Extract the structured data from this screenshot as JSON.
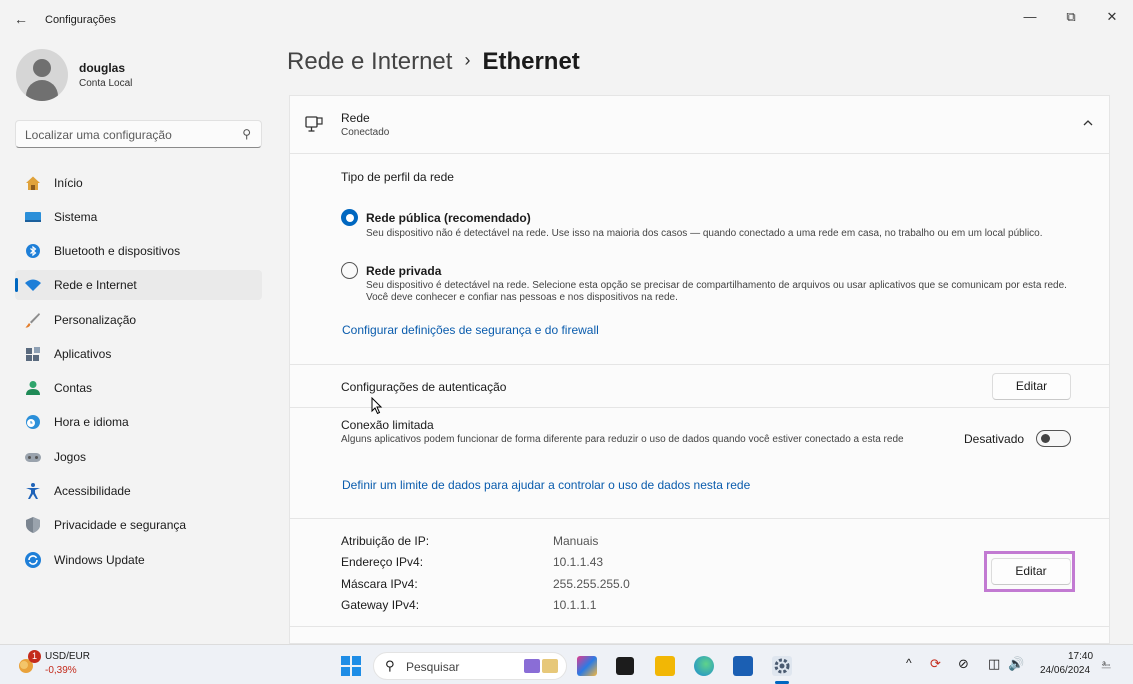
{
  "window": {
    "title": "Configurações",
    "controls": {
      "minimize": "—",
      "restore": "⧉",
      "close": "✕"
    }
  },
  "user": {
    "name": "douglas",
    "account_type": "Conta Local"
  },
  "search": {
    "placeholder": "Localizar uma configuração"
  },
  "sidebar": {
    "items": [
      {
        "label": "Início",
        "icon": "home-icon",
        "active": false
      },
      {
        "label": "Sistema",
        "icon": "system-icon",
        "active": false
      },
      {
        "label": "Bluetooth e dispositivos",
        "icon": "bluetooth-icon",
        "active": false
      },
      {
        "label": "Rede e Internet",
        "icon": "wifi-icon",
        "active": true
      },
      {
        "label": "Personalização",
        "icon": "brush-icon",
        "active": false
      },
      {
        "label": "Aplicativos",
        "icon": "apps-icon",
        "active": false
      },
      {
        "label": "Contas",
        "icon": "accounts-icon",
        "active": false
      },
      {
        "label": "Hora e idioma",
        "icon": "time-language-icon",
        "active": false
      },
      {
        "label": "Jogos",
        "icon": "gamepad-icon",
        "active": false
      },
      {
        "label": "Acessibilidade",
        "icon": "accessibility-icon",
        "active": false
      },
      {
        "label": "Privacidade e segurança",
        "icon": "shield-icon",
        "active": false
      },
      {
        "label": "Windows Update",
        "icon": "update-icon",
        "active": false
      }
    ]
  },
  "breadcrumb": {
    "parent": "Rede e Internet",
    "separator": "›",
    "current": "Ethernet"
  },
  "network": {
    "name": "Rede",
    "status": "Conectado",
    "profile_heading": "Tipo de perfil da rede",
    "profiles": [
      {
        "label": "Rede pública (recomendado)",
        "description": "Seu dispositivo não é detectável na rede. Use isso na maioria dos casos — quando conectado a uma rede em casa, no trabalho ou em um local público.",
        "selected": true
      },
      {
        "label": "Rede privada",
        "description": "Seu dispositivo é detectável na rede. Selecione esta opção se precisar de compartilhamento de arquivos ou usar aplicativos que se comunicam por esta rede. Você deve conhecer e confiar nas pessoas e nos dispositivos na rede.",
        "selected": false
      }
    ],
    "firewall_link": "Configurar definições de segurança e do firewall",
    "auth_label": "Configurações de autenticação",
    "edit_label": "Editar",
    "metered": {
      "label": "Conexão limitada",
      "description": "Alguns aplicativos podem funcionar de forma diferente para reduzir o uso de dados quando você estiver conectado a esta rede",
      "state": "Desativado",
      "on": false
    },
    "data_limit_link": "Definir um limite de dados para ajudar a controlar o uso de dados nesta rede",
    "ip": {
      "rows": [
        {
          "label": "Atribuição de IP:",
          "value": "Manuais"
        },
        {
          "label": "Endereço IPv4:",
          "value": "10.1.1.43"
        },
        {
          "label": "Máscara IPv4:",
          "value": "255.255.255.0"
        },
        {
          "label": "Gateway IPv4:",
          "value": "10.1.1.1"
        }
      ],
      "edit_label": "Editar"
    }
  },
  "taskbar": {
    "widget": {
      "title": "USD/EUR",
      "change": "-0,39%",
      "badge": "1"
    },
    "search_placeholder": "Pesquisar",
    "time": "17:40",
    "date": "24/06/2024"
  },
  "colors": {
    "accent": "#0067c0",
    "link": "#0a5cad",
    "highlight": "#c27ad2",
    "negative": "#c42b1c"
  }
}
